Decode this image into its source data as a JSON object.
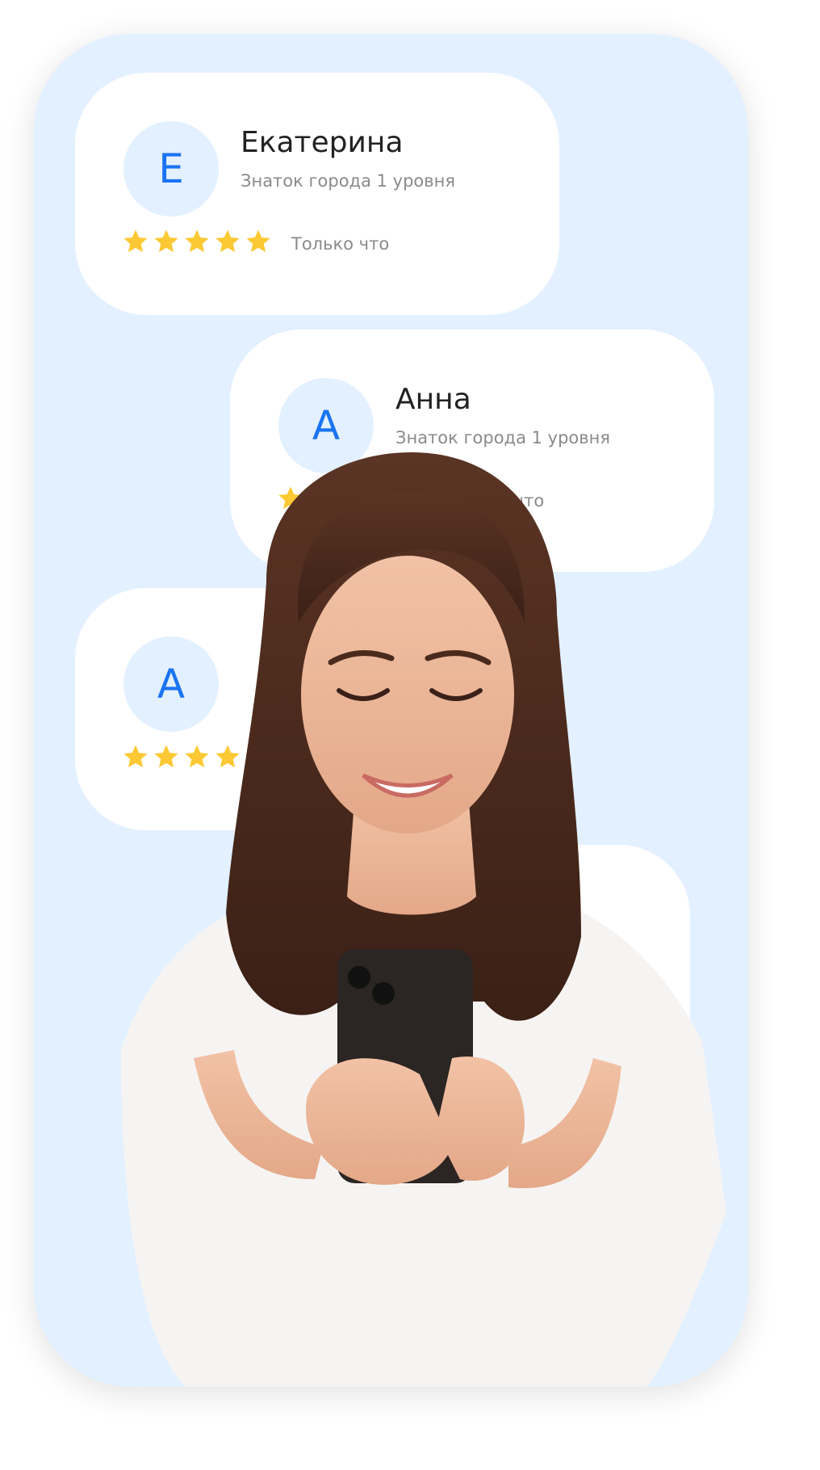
{
  "reviews": [
    {
      "initial": "Е",
      "name": "Екатерина",
      "subtitle": "Знаток города 1 уровня",
      "time": "Только что",
      "rating": 5
    },
    {
      "initial": "А",
      "name": "Анна",
      "subtitle": "Знаток города 1 уровня",
      "time": "Только что",
      "rating": 5
    },
    {
      "initial": "А",
      "name": "",
      "subtitle": "",
      "time": "",
      "rating": 5
    }
  ],
  "colors": {
    "background_panel": "#e3f0ff",
    "accent": "#1a73f2",
    "star": "#fcc934",
    "card": "#ffffff",
    "text_primary": "#222222",
    "text_secondary": "#8a8a8a"
  },
  "icons": {
    "star": "star-icon"
  }
}
